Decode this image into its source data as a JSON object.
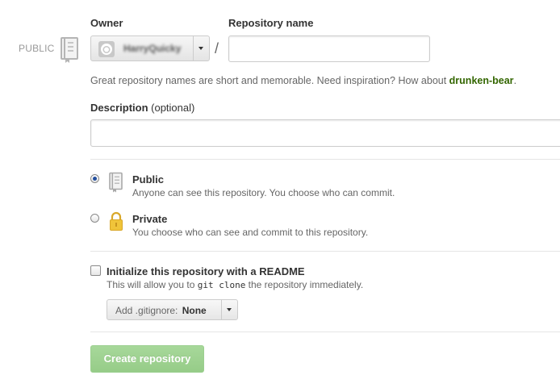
{
  "visibility_badge": "PUBLIC",
  "owner": {
    "label": "Owner",
    "selected": "HarryQuicky"
  },
  "separator": "/",
  "repository_name": {
    "label": "Repository name",
    "value": ""
  },
  "hint": {
    "text": "Great repository names are short and memorable. Need inspiration? How about ",
    "suggestion": "drunken-bear",
    "suffix": "."
  },
  "description": {
    "label": "Description",
    "optional": "(optional)",
    "value": ""
  },
  "visibility": {
    "selected": "public",
    "public": {
      "title": "Public",
      "description": "Anyone can see this repository. You choose who can commit."
    },
    "private": {
      "title": "Private",
      "description": "You choose who can see and commit to this repository."
    }
  },
  "init": {
    "checked": false,
    "title": "Initialize this repository with a README",
    "desc_prefix": "This will allow you to ",
    "desc_code": "git clone",
    "desc_suffix": " the repository immediately."
  },
  "gitignore": {
    "label": "Add .gitignore:",
    "value": "None"
  },
  "submit_label": "Create repository",
  "colors": {
    "accent_green": "#336600",
    "button_green": "#a7d89a",
    "radio_checked": "#234f9e",
    "lock_yellow": "#f0c43a"
  }
}
